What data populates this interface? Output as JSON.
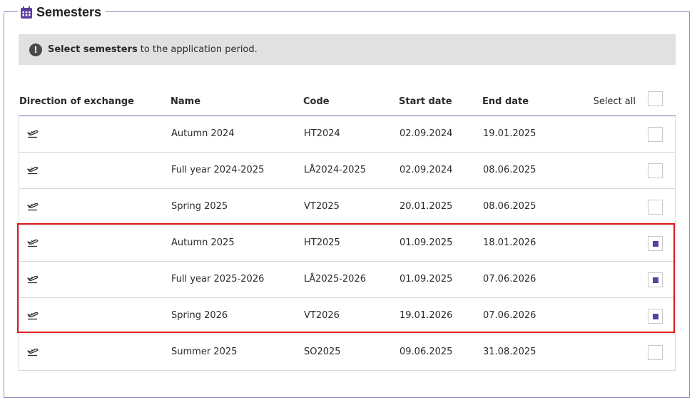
{
  "section": {
    "title": "Semesters"
  },
  "info": {
    "bold": "Select semesters",
    "text": "to the application period."
  },
  "table": {
    "headers": {
      "direction": "Direction of exchange",
      "name": "Name",
      "code": "Code",
      "start": "Start date",
      "end": "End date",
      "select_all": "Select all"
    },
    "rows": [
      {
        "name": "Autumn 2024",
        "code": "HT2024",
        "start": "02.09.2024",
        "end": "19.01.2025",
        "checked": false
      },
      {
        "name": "Full year 2024-2025",
        "code": "LÅ2024-2025",
        "start": "02.09.2024",
        "end": "08.06.2025",
        "checked": false
      },
      {
        "name": "Spring 2025",
        "code": "VT2025",
        "start": "20.01.2025",
        "end": "08.06.2025",
        "checked": false
      },
      {
        "name": "Autumn 2025",
        "code": "HT2025",
        "start": "01.09.2025",
        "end": "18.01.2026",
        "checked": true
      },
      {
        "name": "Full year 2025-2026",
        "code": "LÅ2025-2026",
        "start": "01.09.2025",
        "end": "07.06.2026",
        "checked": true
      },
      {
        "name": "Spring 2026",
        "code": "VT2026",
        "start": "19.01.2026",
        "end": "07.06.2026",
        "checked": true
      },
      {
        "name": "Summer 2025",
        "code": "SO2025",
        "start": "09.06.2025",
        "end": "31.08.2025",
        "checked": false
      }
    ]
  },
  "colors": {
    "accent": "#5b3fa1",
    "highlight": "#e01e1e"
  },
  "icons": {
    "section": "calendar-icon",
    "info": "exclamation-icon",
    "direction": "plane-departure-icon"
  }
}
